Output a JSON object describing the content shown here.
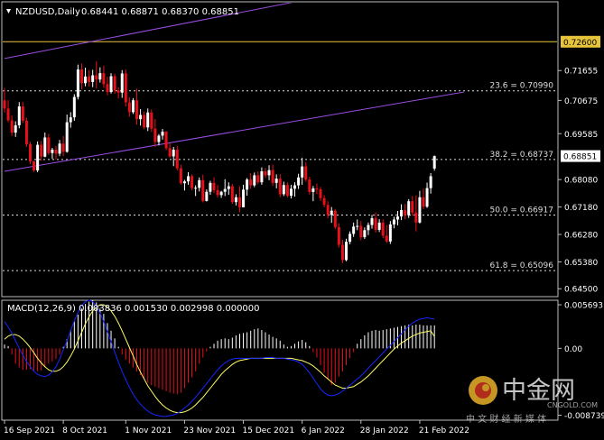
{
  "header": {
    "symbol_label": "NZDUSD,Daily",
    "ohlc_values": "0.68441 0.68871 0.68370 0.68851"
  },
  "indicator": {
    "label": "MACD(12,26,9) 0.003836 0.001530 0.002998 0.000000"
  },
  "colors": {
    "background": "#000000",
    "bull_candle": "#ffffff",
    "bear_candle": "#e8101a",
    "fibo_line": "#dddddd",
    "channel_line": "#9a4de0",
    "horizontal_level": "#e8c43a",
    "macd_line": "#1726ff",
    "signal_line": "#ffff66",
    "hist_positive": "#ffffff",
    "hist_negative": "#e8101a",
    "axis_text": "#ffffff"
  },
  "watermark": {
    "logo_text": "中金网",
    "site_text": "CNGOLD.COM",
    "slogan": "中 文 财 经 新 媒 体"
  },
  "chart_data": [
    {
      "type": "candlestick",
      "title": "NZDUSD,Daily",
      "ylim": [
        0.643,
        0.7385
      ],
      "y_ticks": [
        "0.71655",
        "0.70675",
        "0.69585",
        "0.68080",
        "0.67180",
        "0.66280",
        "0.65380",
        "0.64500"
      ],
      "price_marker": {
        "value": 0.68851,
        "label": "0.68851"
      },
      "level_marker": {
        "value": 0.726,
        "label": "0.72600"
      },
      "x_tick_labels": [
        "16 Sep 2021",
        "8 Oct 2021",
        "1 Nov 2021",
        "23 Nov 2021",
        "15 Dec 2021",
        "6 Jan 2022",
        "28 Jan 2022",
        "21 Feb 2022"
      ],
      "x_tick_index": [
        0,
        16,
        33,
        49,
        65,
        81,
        97,
        113
      ],
      "fibonacci_levels": [
        {
          "label": "23.6 = 0.70990",
          "value": 0.7099
        },
        {
          "label": "38.2 = 0.68737",
          "value": 0.68737
        },
        {
          "label": "50.0 = 0.66917",
          "value": 0.66917
        },
        {
          "label": "61.8 = 0.65096",
          "value": 0.65096
        }
      ],
      "channel_lines": [
        {
          "i1": 0,
          "v1": 0.7205,
          "i2": 100,
          "v2": 0.744
        },
        {
          "i1": 0,
          "v1": 0.6835,
          "i2": 125,
          "v2": 0.7095
        }
      ],
      "candles": [
        [
          0.7068,
          0.7108,
          0.7028,
          0.7041
        ],
        [
          0.7041,
          0.7068,
          0.6996,
          0.7002
        ],
        [
          0.7002,
          0.7018,
          0.6951,
          0.6962
        ],
        [
          0.6962,
          0.6999,
          0.6948,
          0.6986
        ],
        [
          0.6986,
          0.7062,
          0.6976,
          0.7048
        ],
        [
          0.7048,
          0.7062,
          0.6993,
          0.7001
        ],
        [
          0.7001,
          0.7011,
          0.6915,
          0.6924
        ],
        [
          0.6924,
          0.6932,
          0.6859,
          0.6868
        ],
        [
          0.6868,
          0.6869,
          0.6833,
          0.6838
        ],
        [
          0.6838,
          0.6933,
          0.6832,
          0.6922
        ],
        [
          0.6922,
          0.6935,
          0.687,
          0.6883
        ],
        [
          0.6883,
          0.6962,
          0.6881,
          0.6946
        ],
        [
          0.6946,
          0.6958,
          0.6889,
          0.6895
        ],
        [
          0.6895,
          0.6912,
          0.6876,
          0.6906
        ],
        [
          0.6906,
          0.6918,
          0.6874,
          0.6893
        ],
        [
          0.6893,
          0.6938,
          0.6885,
          0.6926
        ],
        [
          0.6926,
          0.6951,
          0.6884,
          0.6899
        ],
        [
          0.6899,
          0.7021,
          0.6896,
          0.6996
        ],
        [
          0.6996,
          0.7029,
          0.6978,
          0.7012
        ],
        [
          0.7012,
          0.7088,
          0.7001,
          0.7079
        ],
        [
          0.7079,
          0.7185,
          0.7071,
          0.7169
        ],
        [
          0.7169,
          0.7188,
          0.7104,
          0.7124
        ],
        [
          0.7124,
          0.7175,
          0.7114,
          0.7146
        ],
        [
          0.7146,
          0.7167,
          0.7113,
          0.7128
        ],
        [
          0.7128,
          0.7168,
          0.7111,
          0.715
        ],
        [
          0.715,
          0.7196,
          0.7107,
          0.7136
        ],
        [
          0.7136,
          0.7176,
          0.7126,
          0.7157
        ],
        [
          0.7157,
          0.7181,
          0.7109,
          0.7121
        ],
        [
          0.7121,
          0.7145,
          0.7084,
          0.7095
        ],
        [
          0.7095,
          0.7157,
          0.709,
          0.7147
        ],
        [
          0.7147,
          0.7155,
          0.7089,
          0.71
        ],
        [
          0.71,
          0.711,
          0.7074,
          0.7093
        ],
        [
          0.7093,
          0.7167,
          0.7076,
          0.7156
        ],
        [
          0.7156,
          0.7169,
          0.7048,
          0.7061
        ],
        [
          0.7061,
          0.7078,
          0.7014,
          0.7029
        ],
        [
          0.7029,
          0.7075,
          0.7023,
          0.7068
        ],
        [
          0.7068,
          0.7106,
          0.6988,
          0.7006
        ],
        [
          0.7006,
          0.7039,
          0.6985,
          0.702
        ],
        [
          0.702,
          0.7031,
          0.6973,
          0.6979
        ],
        [
          0.6979,
          0.7041,
          0.6967,
          0.7028
        ],
        [
          0.7028,
          0.7038,
          0.6964,
          0.6975
        ],
        [
          0.6975,
          0.7006,
          0.6915,
          0.6931
        ],
        [
          0.6931,
          0.6957,
          0.692,
          0.6952
        ],
        [
          0.6952,
          0.6974,
          0.6939,
          0.6965
        ],
        [
          0.6965,
          0.6967,
          0.6904,
          0.6911
        ],
        [
          0.6911,
          0.6927,
          0.6879,
          0.6884
        ],
        [
          0.6884,
          0.6915,
          0.6852,
          0.6906
        ],
        [
          0.6906,
          0.6919,
          0.6838,
          0.6845
        ],
        [
          0.6845,
          0.6857,
          0.6791,
          0.6796
        ],
        [
          0.6796,
          0.6807,
          0.6772,
          0.6802
        ],
        [
          0.6802,
          0.6832,
          0.6791,
          0.6819
        ],
        [
          0.6819,
          0.6825,
          0.6773,
          0.678
        ],
        [
          0.678,
          0.6789,
          0.6754,
          0.6781
        ],
        [
          0.6781,
          0.6815,
          0.6769,
          0.6806
        ],
        [
          0.6806,
          0.6824,
          0.6733,
          0.6738
        ],
        [
          0.6738,
          0.6776,
          0.6736,
          0.6768
        ],
        [
          0.6768,
          0.6804,
          0.6758,
          0.6797
        ],
        [
          0.6797,
          0.6815,
          0.6764,
          0.6773
        ],
        [
          0.6773,
          0.679,
          0.6749,
          0.6757
        ],
        [
          0.6757,
          0.6771,
          0.6748,
          0.6768
        ],
        [
          0.6768,
          0.6809,
          0.6754,
          0.6777
        ],
        [
          0.6777,
          0.6799,
          0.6758,
          0.6786
        ],
        [
          0.6786,
          0.6794,
          0.6728,
          0.6734
        ],
        [
          0.6734,
          0.676,
          0.6723,
          0.675
        ],
        [
          0.675,
          0.6786,
          0.6701,
          0.6717
        ],
        [
          0.6717,
          0.6791,
          0.6717,
          0.6775
        ],
        [
          0.6775,
          0.6813,
          0.6755,
          0.6808
        ],
        [
          0.6808,
          0.6829,
          0.6778,
          0.6789
        ],
        [
          0.6789,
          0.6831,
          0.6783,
          0.6822
        ],
        [
          0.6822,
          0.6835,
          0.6793,
          0.6799
        ],
        [
          0.6799,
          0.6848,
          0.6791,
          0.6835
        ],
        [
          0.6835,
          0.6846,
          0.6813,
          0.6822
        ],
        [
          0.6822,
          0.6855,
          0.6806,
          0.6839
        ],
        [
          0.6839,
          0.6857,
          0.6787,
          0.6797
        ],
        [
          0.6797,
          0.6825,
          0.6779,
          0.6811
        ],
        [
          0.6811,
          0.6826,
          0.675,
          0.676
        ],
        [
          0.676,
          0.6801,
          0.6754,
          0.679
        ],
        [
          0.679,
          0.6799,
          0.6749,
          0.6755
        ],
        [
          0.6755,
          0.6791,
          0.6746,
          0.6778
        ],
        [
          0.6778,
          0.6799,
          0.6752,
          0.6789
        ],
        [
          0.6789,
          0.6827,
          0.6777,
          0.6815
        ],
        [
          0.6815,
          0.6879,
          0.6791,
          0.6851
        ],
        [
          0.6851,
          0.6865,
          0.6801,
          0.6808
        ],
        [
          0.6808,
          0.6817,
          0.6759,
          0.6767
        ],
        [
          0.6767,
          0.6787,
          0.6737,
          0.6779
        ],
        [
          0.6779,
          0.6795,
          0.676,
          0.6776
        ],
        [
          0.6776,
          0.6784,
          0.6738,
          0.6747
        ],
        [
          0.6747,
          0.6757,
          0.6717,
          0.6725
        ],
        [
          0.6725,
          0.6737,
          0.6681,
          0.6692
        ],
        [
          0.6692,
          0.6718,
          0.6666,
          0.6706
        ],
        [
          0.6706,
          0.6712,
          0.6646,
          0.6652
        ],
        [
          0.6652,
          0.6665,
          0.6585,
          0.6594
        ],
        [
          0.6594,
          0.6611,
          0.6534,
          0.6544
        ],
        [
          0.6544,
          0.6614,
          0.654,
          0.6604
        ],
        [
          0.6604,
          0.6638,
          0.6596,
          0.663
        ],
        [
          0.663,
          0.6667,
          0.662,
          0.6654
        ],
        [
          0.6654,
          0.6677,
          0.6642,
          0.6656
        ],
        [
          0.6656,
          0.6672,
          0.6609,
          0.6619
        ],
        [
          0.6619,
          0.6651,
          0.6613,
          0.6642
        ],
        [
          0.6642,
          0.6667,
          0.6626,
          0.6659
        ],
        [
          0.6659,
          0.6692,
          0.6647,
          0.6681
        ],
        [
          0.6681,
          0.6701,
          0.6634,
          0.6643
        ],
        [
          0.6643,
          0.6678,
          0.6636,
          0.6667
        ],
        [
          0.6667,
          0.6678,
          0.6615,
          0.6624
        ],
        [
          0.6624,
          0.6659,
          0.66,
          0.6605
        ],
        [
          0.6605,
          0.6672,
          0.6597,
          0.6661
        ],
        [
          0.6661,
          0.6686,
          0.6648,
          0.6677
        ],
        [
          0.6677,
          0.6705,
          0.6658,
          0.6687
        ],
        [
          0.6687,
          0.6727,
          0.6675,
          0.6708
        ],
        [
          0.6708,
          0.6728,
          0.6678,
          0.6691
        ],
        [
          0.6691,
          0.6744,
          0.6682,
          0.6737
        ],
        [
          0.6737,
          0.6754,
          0.6689,
          0.67
        ],
        [
          0.67,
          0.6756,
          0.6638,
          0.6667
        ],
        [
          0.6667,
          0.6771,
          0.6664,
          0.675
        ],
        [
          0.675,
          0.6778,
          0.6711,
          0.6719
        ],
        [
          0.6719,
          0.6798,
          0.6715,
          0.678
        ],
        [
          0.678,
          0.6829,
          0.6762,
          0.6819
        ],
        [
          0.6844,
          0.6887,
          0.6837,
          0.6885
        ]
      ]
    },
    {
      "type": "macd",
      "title": "MACD(12,26,9)",
      "values": {
        "macd": 0.003836,
        "signal": 0.00153,
        "histogram": 0.002998,
        "extra": 0.0
      },
      "ylim": [
        -0.00915,
        0.00605
      ],
      "y_ticks": [
        "0.005693",
        "0.00",
        "-0.008739"
      ],
      "histogram": [
        0.0005,
        0.0003,
        -0.0008,
        -0.002,
        -0.0025,
        -0.0028,
        -0.0028,
        -0.0027,
        -0.0029,
        -0.003,
        -0.0029,
        -0.0024,
        -0.002,
        -0.0017,
        -0.0014,
        -0.0008,
        0.0002,
        0.0012,
        0.0024,
        0.0035,
        0.0044,
        0.0052,
        0.0058,
        0.0061,
        0.0063,
        0.006,
        0.0052,
        0.0045,
        0.0033,
        0.0023,
        0.0013,
        0.0002,
        -0.0008,
        -0.0015,
        -0.002,
        -0.0025,
        -0.003,
        -0.0035,
        -0.004,
        -0.0045,
        -0.0048,
        -0.005,
        -0.0052,
        -0.0054,
        -0.0056,
        -0.0058,
        -0.0059,
        -0.006,
        -0.0058,
        -0.0052,
        -0.0045,
        -0.0038,
        -0.003,
        -0.002,
        -0.0012,
        -0.0004,
        0.0002,
        0.0006,
        0.001,
        0.0012,
        0.0013,
        0.0012,
        0.0014,
        0.0017,
        0.0019,
        0.002,
        0.0021,
        0.0023,
        0.0025,
        0.0026,
        0.0024,
        0.0021,
        0.0018,
        0.0015,
        0.0013,
        0.001,
        0.0005,
        0.0002,
        0.0003,
        0.0006,
        0.0009,
        0.0011,
        0.0008,
        0.0003,
        -0.0005,
        -0.0012,
        -0.0022,
        -0.0032,
        -0.0041,
        -0.0048,
        -0.0045,
        -0.0037,
        -0.003,
        -0.0022,
        -0.0013,
        -0.0005,
        0.0006,
        0.0012,
        0.0017,
        0.0021,
        0.0023,
        0.0024,
        0.0023,
        0.0024,
        0.0025,
        0.0026,
        0.0027,
        0.0028,
        0.0029,
        0.003,
        0.0031,
        0.003,
        0.0031,
        0.0031,
        0.003,
        0.003,
        0.003,
        0.003
      ],
      "macd_line": [
        0.0035,
        0.0028,
        0.002,
        0.001,
        0.0,
        -0.0009,
        -0.0017,
        -0.0024,
        -0.003,
        -0.0034,
        -0.0036,
        -0.0037,
        -0.0035,
        -0.0031,
        -0.0024,
        -0.0014,
        -0.0002,
        0.001,
        0.0023,
        0.0036,
        0.0047,
        0.0056,
        0.0061,
        0.0063,
        0.0061,
        0.0055,
        0.0046,
        0.0035,
        0.0022,
        0.0009,
        -0.0005,
        -0.0018,
        -0.003,
        -0.0041,
        -0.0051,
        -0.006,
        -0.0067,
        -0.0073,
        -0.0078,
        -0.0082,
        -0.0085,
        -0.0087,
        -0.0088,
        -0.0089,
        -0.0089,
        -0.0088,
        -0.0087,
        -0.0085,
        -0.0082,
        -0.0078,
        -0.0074,
        -0.0069,
        -0.0064,
        -0.0058,
        -0.0052,
        -0.0046,
        -0.004,
        -0.0034,
        -0.0028,
        -0.0023,
        -0.0019,
        -0.0016,
        -0.0014,
        -0.0013,
        -0.0013,
        -0.0013,
        -0.0013,
        -0.0013,
        -0.0013,
        -0.0013,
        -0.0013,
        -0.0012,
        -0.0012,
        -0.0012,
        -0.0013,
        -0.0013,
        -0.0013,
        -0.0014,
        -0.0015,
        -0.0016,
        -0.0018,
        -0.0021,
        -0.0026,
        -0.0032,
        -0.0039,
        -0.0046,
        -0.0053,
        -0.0058,
        -0.0061,
        -0.0062,
        -0.0061,
        -0.0059,
        -0.0056,
        -0.0052,
        -0.0048,
        -0.0044,
        -0.004,
        -0.0036,
        -0.0031,
        -0.0026,
        -0.0021,
        -0.0016,
        -0.0011,
        -0.0006,
        -0.0001,
        0.0004,
        0.0009,
        0.0014,
        0.0019,
        0.0024,
        0.0029,
        0.0033,
        0.0036,
        0.0038,
        0.0039,
        0.004,
        0.0039,
        0.003836
      ],
      "signal_line": [
        0.0012,
        0.0016,
        0.0018,
        0.0018,
        0.0016,
        0.0012,
        0.0007,
        0.0001,
        -0.0006,
        -0.0013,
        -0.0019,
        -0.0024,
        -0.0028,
        -0.003,
        -0.003,
        -0.0028,
        -0.0024,
        -0.0018,
        -0.001,
        -0.0001,
        0.001,
        0.0021,
        0.0032,
        0.0041,
        0.0049,
        0.0054,
        0.0057,
        0.0057,
        0.0054,
        0.0049,
        0.0042,
        0.0033,
        0.0023,
        0.0012,
        0.0001,
        -0.001,
        -0.0021,
        -0.0031,
        -0.004,
        -0.0049,
        -0.0056,
        -0.0063,
        -0.0069,
        -0.0074,
        -0.0078,
        -0.0081,
        -0.0083,
        -0.0084,
        -0.0084,
        -0.0083,
        -0.0081,
        -0.0078,
        -0.0074,
        -0.0069,
        -0.0064,
        -0.0058,
        -0.0052,
        -0.0046,
        -0.004,
        -0.0034,
        -0.0029,
        -0.0025,
        -0.0021,
        -0.0018,
        -0.0016,
        -0.0015,
        -0.0014,
        -0.0013,
        -0.0013,
        -0.0013,
        -0.0013,
        -0.0013,
        -0.0013,
        -0.0013,
        -0.0013,
        -0.0013,
        -0.0013,
        -0.0013,
        -0.0013,
        -0.0014,
        -0.0015,
        -0.0016,
        -0.0018,
        -0.002,
        -0.0023,
        -0.0027,
        -0.0031,
        -0.0036,
        -0.004,
        -0.0044,
        -0.0048,
        -0.005,
        -0.0052,
        -0.0052,
        -0.0051,
        -0.005,
        -0.0047,
        -0.0044,
        -0.004,
        -0.0036,
        -0.0031,
        -0.0026,
        -0.0021,
        -0.0016,
        -0.0011,
        -0.0006,
        -0.0001,
        0.0003,
        0.0007,
        0.001,
        0.0013,
        0.0016,
        0.0018,
        0.002,
        0.0021,
        0.0022,
        0.0023,
        0.00153
      ]
    }
  ]
}
